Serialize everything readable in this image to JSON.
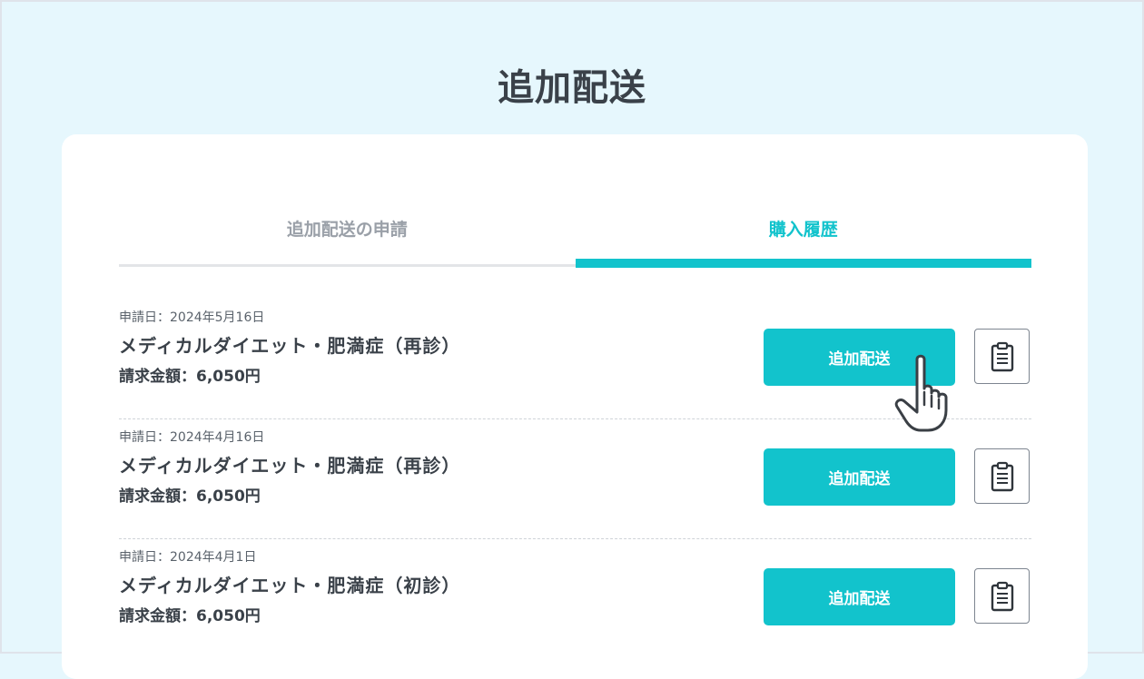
{
  "page": {
    "title": "追加配送"
  },
  "tabs": [
    {
      "label": "追加配送の申請",
      "active": false
    },
    {
      "label": "購入履歴",
      "active": true
    }
  ],
  "history": [
    {
      "date": "申請日：2024年5月16日",
      "product": "メディカルダイエット・肥満症（再診）",
      "amount": "請求金額：6,050円",
      "button_label": "追加配送"
    },
    {
      "date": "申請日：2024年4月16日",
      "product": "メディカルダイエット・肥満症（再診）",
      "amount": "請求金額：6,050円",
      "button_label": "追加配送"
    },
    {
      "date": "申請日：2024年4月1日",
      "product": "メディカルダイエット・肥満症（初診）",
      "amount": "請求金額：6,050円",
      "button_label": "追加配送"
    }
  ],
  "icons": {
    "detail_button": "clipboard-icon",
    "pointer": "hand-pointer-icon"
  },
  "colors": {
    "accent": "#12c3cc",
    "background": "#e6f7fd",
    "card": "#ffffff",
    "text": "#3a4149",
    "inactive_tab": "#9aa0a8"
  }
}
